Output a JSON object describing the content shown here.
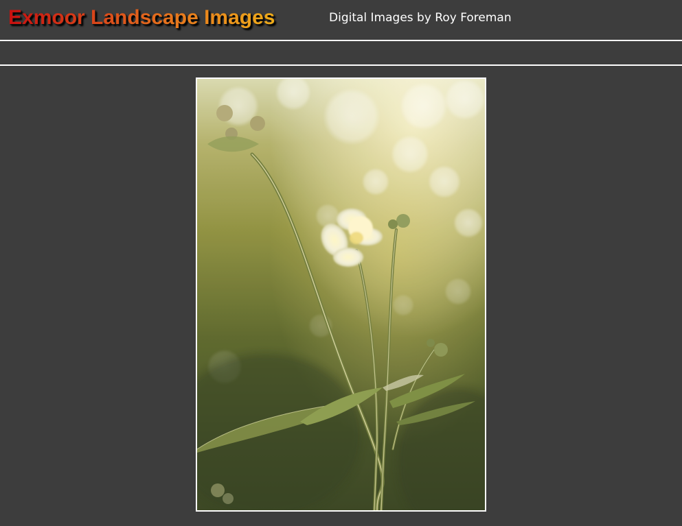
{
  "header": {
    "site_title": "Exmoor Landscape Images",
    "subtitle": "Digital Images by Roy Foreman"
  },
  "navigation": {
    "items": []
  },
  "main": {
    "photo": {
      "icon": "photograph-backlit-wildflower-image"
    }
  },
  "colors": {
    "background": "#3d3d3d",
    "rule": "#ffffff",
    "title_gradient_start": "#c8100f",
    "title_gradient_end": "#efad1a",
    "subtitle_text": "#ffffff"
  }
}
